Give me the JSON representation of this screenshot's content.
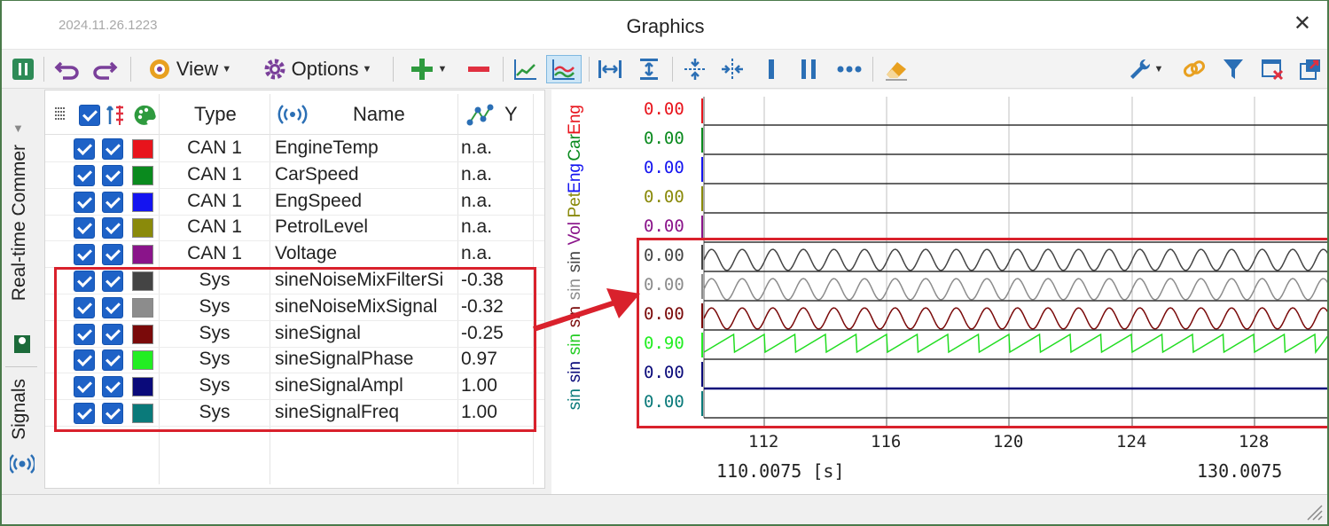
{
  "window": {
    "version": "2024.11.26.1223",
    "title": "Graphics",
    "close_glyph": "✕"
  },
  "toolbar": {
    "view_label": "View",
    "options_label": "Options"
  },
  "sidetabs": {
    "realtime": "Real-time Commer",
    "signals": "Signals"
  },
  "signals_table": {
    "headers": {
      "type": "Type",
      "name": "Name",
      "y": "Y"
    },
    "rows": [
      {
        "type": "CAN 1",
        "name": "EngineTemp",
        "y": "n.a.",
        "color": "#e8141c"
      },
      {
        "type": "CAN 1",
        "name": "CarSpeed",
        "y": "n.a.",
        "color": "#0a8a1e"
      },
      {
        "type": "CAN 1",
        "name": "EngSpeed",
        "y": "n.a.",
        "color": "#1414f0"
      },
      {
        "type": "CAN 1",
        "name": "PetrolLevel",
        "y": "n.a.",
        "color": "#8a8a0a"
      },
      {
        "type": "CAN 1",
        "name": "Voltage",
        "y": "n.a.",
        "color": "#8a148a"
      },
      {
        "type": "Sys",
        "name": "sineNoiseMixFilterSi",
        "y": "-0.38",
        "color": "#444444"
      },
      {
        "type": "Sys",
        "name": "sineNoiseMixSignal",
        "y": "-0.32",
        "color": "#8c8c8c"
      },
      {
        "type": "Sys",
        "name": "sineSignal",
        "y": "-0.25",
        "color": "#7a0a0a"
      },
      {
        "type": "Sys",
        "name": "sineSignalPhase",
        "y": "0.97",
        "color": "#22ee22"
      },
      {
        "type": "Sys",
        "name": "sineSignalAmpl",
        "y": "1.00",
        "color": "#0a0a7a"
      },
      {
        "type": "Sys",
        "name": "sineSignalFreq",
        "y": "1.00",
        "color": "#0a7a7a"
      }
    ]
  },
  "graph": {
    "vertical_labels": [
      {
        "text": "sin",
        "color": "#0a7a7a"
      },
      {
        "text": "sin",
        "color": "#0a0a7a"
      },
      {
        "text": "sin",
        "color": "#22cc22"
      },
      {
        "text": "sin",
        "color": "#7a0a0a"
      },
      {
        "text": "sin",
        "color": "#8c8c8c"
      },
      {
        "text": "sin",
        "color": "#444444"
      },
      {
        "text": "Vol",
        "color": "#8a148a"
      },
      {
        "text": "Pet",
        "color": "#8a8a0a"
      },
      {
        "text": "Eng",
        "color": "#1414f0"
      },
      {
        "text": "Car",
        "color": "#0a8a1e"
      },
      {
        "text": "Eng",
        "color": "#e8141c"
      }
    ],
    "y_labels": [
      {
        "text": "0.00",
        "color": "#e8141c"
      },
      {
        "text": "0.00",
        "color": "#0a8a1e"
      },
      {
        "text": "0.00",
        "color": "#1414f0"
      },
      {
        "text": "0.00",
        "color": "#8a8a0a"
      },
      {
        "text": "0.00",
        "color": "#8a148a"
      },
      {
        "text": "0.00",
        "color": "#444444"
      },
      {
        "text": "0.00",
        "color": "#8c8c8c"
      },
      {
        "text": "0.00",
        "color": "#7a0a0a"
      },
      {
        "text": "0.90",
        "color": "#22ee22"
      },
      {
        "text": "0.00",
        "color": "#0a0a7a"
      },
      {
        "text": "0.00",
        "color": "#0a7a7a"
      }
    ],
    "x_ticks": [
      "112",
      "116",
      "120",
      "124",
      "128"
    ],
    "x_start": "110.0075 [s]",
    "x_end": "130.0075"
  },
  "highlight_color": "#d9212c"
}
